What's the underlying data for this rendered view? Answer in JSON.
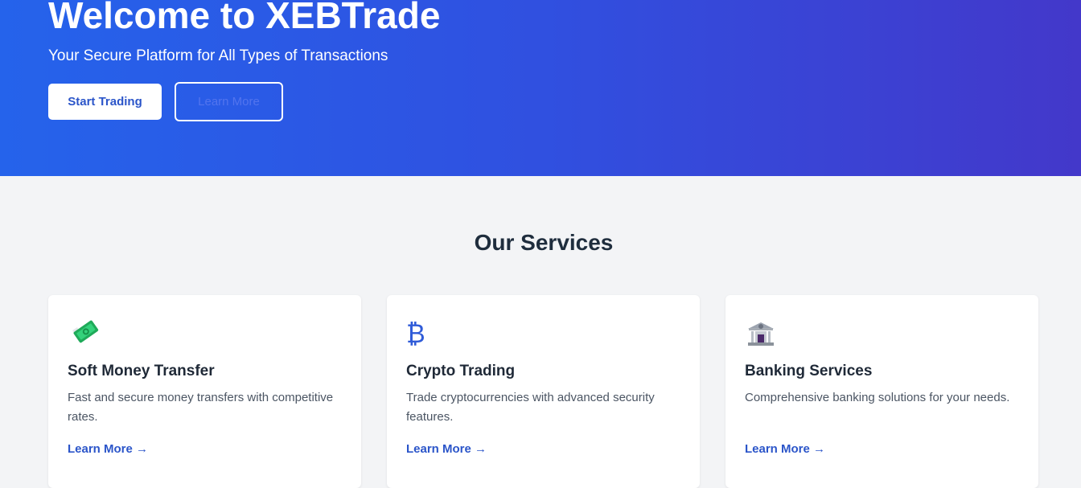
{
  "hero": {
    "title": "Welcome to XEBTrade",
    "subtitle": "Your Secure Platform for All Types of Transactions",
    "primary_button": "Start Trading",
    "secondary_button": "Learn More"
  },
  "services": {
    "title": "Our Services",
    "cards": [
      {
        "icon": "money-with-wings-icon",
        "title": "Soft Money Transfer",
        "description": "Fast and secure money transfers with competitive rates.",
        "link": "Learn More →"
      },
      {
        "icon": "bitcoin-icon",
        "title": "Crypto Trading",
        "description": "Trade cryptocurrencies with advanced security features.",
        "link": "Learn More →"
      },
      {
        "icon": "bank-icon",
        "title": "Banking Services",
        "description": "Comprehensive banking solutions for your needs.",
        "link": "Learn More →"
      }
    ]
  },
  "colors": {
    "hero_gradient_start": "#2563eb",
    "hero_gradient_end": "#4338ca",
    "accent": "#2b55c9",
    "page_background": "#f3f4f6"
  },
  "icons": {
    "bitcoin_glyph": "₿"
  }
}
